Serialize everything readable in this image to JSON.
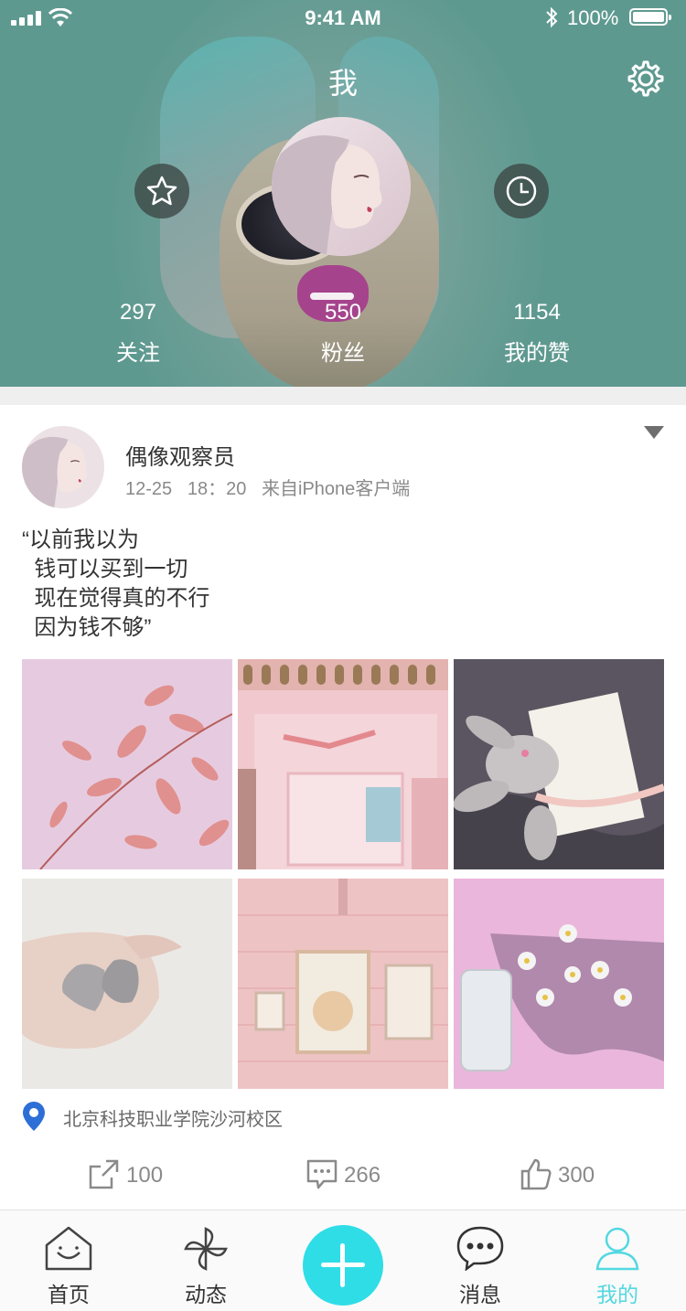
{
  "status_bar": {
    "time": "9:41 AM",
    "battery": "100%"
  },
  "header": {
    "title": "我",
    "stats": [
      {
        "value": "297",
        "label": "关注"
      },
      {
        "value": "550",
        "label": "粉丝"
      },
      {
        "value": "1154",
        "label": "我的赞"
      }
    ]
  },
  "post": {
    "author": "偶像观察员",
    "date": "12-25",
    "time": "18：20",
    "source": "来自iPhone客户端",
    "text_lines": [
      "“以前我以为",
      "  钱可以买到一切",
      "  现在觉得真的不行",
      "  因为钱不够”"
    ],
    "location": "北京科技职业学院沙河校区",
    "shares": "100",
    "comments": "266",
    "likes": "300"
  },
  "tabbar": {
    "items": [
      "首页",
      "动态",
      "消息",
      "我的"
    ],
    "active_color": "#2fdde7"
  },
  "colors": {
    "header_bg": "#6aa39a",
    "accent": "#2fdde7"
  }
}
